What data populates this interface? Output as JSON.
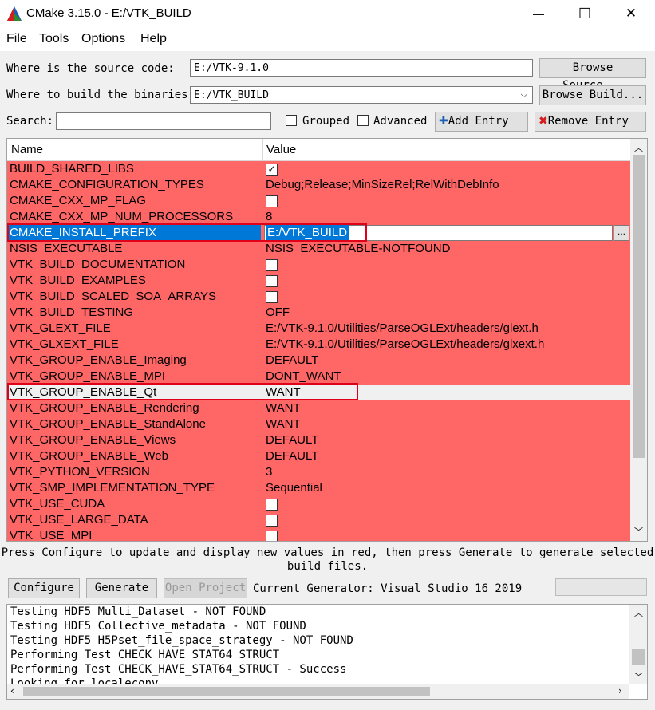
{
  "window": {
    "title": "CMake 3.15.0 - E:/VTK_BUILD",
    "minimize": "—",
    "maximize": "☐",
    "close": "✕"
  },
  "menu": [
    "File",
    "Tools",
    "Options",
    "Help"
  ],
  "source": {
    "label": "Where is the source code:",
    "value": "E:/VTK-9.1.0",
    "button": "Browse Source..."
  },
  "build": {
    "label": "Where to build the binaries:",
    "value": "E:/VTK_BUILD",
    "button": "Browse Build..."
  },
  "search": {
    "label": "Search:",
    "value": "",
    "grouped": "Grouped",
    "advanced": "Advanced",
    "add_entry": "Add Entry",
    "remove_entry": "Remove Entry"
  },
  "table": {
    "col_name": "Name",
    "col_value": "Value",
    "rows": [
      {
        "name": "BUILD_SHARED_LIBS",
        "value": "",
        "checkbox": true,
        "checked": true
      },
      {
        "name": "CMAKE_CONFIGURATION_TYPES",
        "value": "Debug;Release;MinSizeRel;RelWithDebInfo"
      },
      {
        "name": "CMAKE_CXX_MP_FLAG",
        "value": "",
        "checkbox": true,
        "checked": false
      },
      {
        "name": "CMAKE_CXX_MP_NUM_PROCESSORS",
        "value": "8"
      },
      {
        "name": "CMAKE_INSTALL_PREFIX",
        "value": "E:/VTK_BUILD",
        "selected": true
      },
      {
        "name": "NSIS_EXECUTABLE",
        "value": "NSIS_EXECUTABLE-NOTFOUND"
      },
      {
        "name": "VTK_BUILD_DOCUMENTATION",
        "value": "",
        "checkbox": true,
        "checked": false
      },
      {
        "name": "VTK_BUILD_EXAMPLES",
        "value": "",
        "checkbox": true,
        "checked": false
      },
      {
        "name": "VTK_BUILD_SCALED_SOA_ARRAYS",
        "value": "",
        "checkbox": true,
        "checked": false
      },
      {
        "name": "VTK_BUILD_TESTING",
        "value": "OFF"
      },
      {
        "name": "VTK_GLEXT_FILE",
        "value": "E:/VTK-9.1.0/Utilities/ParseOGLExt/headers/glext.h"
      },
      {
        "name": "VTK_GLXEXT_FILE",
        "value": "E:/VTK-9.1.0/Utilities/ParseOGLExt/headers/glxext.h"
      },
      {
        "name": "VTK_GROUP_ENABLE_Imaging",
        "value": "DEFAULT"
      },
      {
        "name": "VTK_GROUP_ENABLE_MPI",
        "value": "DONT_WANT"
      },
      {
        "name": "VTK_GROUP_ENABLE_Qt",
        "value": "WANT",
        "plain": true
      },
      {
        "name": "VTK_GROUP_ENABLE_Rendering",
        "value": "WANT"
      },
      {
        "name": "VTK_GROUP_ENABLE_StandAlone",
        "value": "WANT"
      },
      {
        "name": "VTK_GROUP_ENABLE_Views",
        "value": "DEFAULT"
      },
      {
        "name": "VTK_GROUP_ENABLE_Web",
        "value": "DEFAULT"
      },
      {
        "name": "VTK_PYTHON_VERSION",
        "value": "3"
      },
      {
        "name": "VTK_SMP_IMPLEMENTATION_TYPE",
        "value": "Sequential"
      },
      {
        "name": "VTK_USE_CUDA",
        "value": "",
        "checkbox": true,
        "checked": false
      },
      {
        "name": "VTK_USE_LARGE_DATA",
        "value": "",
        "checkbox": true,
        "checked": false
      },
      {
        "name": "VTK_USE_MPI",
        "value": "",
        "checkbox": true,
        "checked": false
      }
    ],
    "ellipsis": "..."
  },
  "hint": {
    "line1": "Press Configure to update and display new values in red, then press Generate to generate selected",
    "line2": "build files."
  },
  "actions": {
    "configure": "Configure",
    "generate": "Generate",
    "open_project": "Open Project",
    "generator": "Current Generator: Visual Studio 16 2019"
  },
  "console": [
    "Testing HDF5 Multi_Dataset - NOT FOUND",
    "Testing HDF5 Collective_metadata - NOT FOUND",
    "Testing HDF5 H5Pset_file_space_strategy - NOT FOUND",
    "Performing Test CHECK_HAVE_STAT64_STRUCT",
    "Performing Test CHECK_HAVE_STAT64_STRUCT - Success",
    "Looking for localeconv"
  ],
  "colors": {
    "changed_row": "#ff6666",
    "selection": "#0078d7",
    "highlight_box": "#e0001a"
  }
}
